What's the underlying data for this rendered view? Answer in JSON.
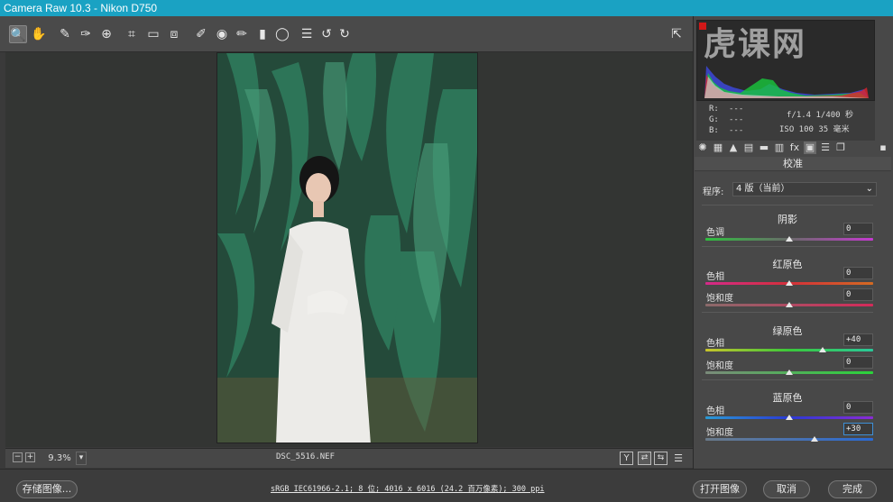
{
  "window": {
    "title": "Camera Raw 10.3 -  Nikon D750"
  },
  "toolbar": {
    "tools": [
      {
        "name": "zoom-tool",
        "icon": "magnifier-icon",
        "glyph": "🔍"
      },
      {
        "name": "hand-tool",
        "icon": "hand-icon",
        "glyph": "✋"
      },
      {
        "name": "white-balance-tool",
        "icon": "eyedropper-icon",
        "glyph": "✎"
      },
      {
        "name": "color-sampler-tool",
        "icon": "sampler-icon",
        "glyph": "✑"
      },
      {
        "name": "targeted-adjustment-tool",
        "icon": "target-icon",
        "glyph": "⊕"
      },
      {
        "name": "crop-tool",
        "icon": "crop-icon",
        "glyph": "⌗"
      },
      {
        "name": "straighten-tool",
        "icon": "ruler-icon",
        "glyph": "▭"
      },
      {
        "name": "transform-tool",
        "icon": "transform-icon",
        "glyph": "⧈"
      },
      {
        "name": "spot-removal-tool",
        "icon": "brush-heal-icon",
        "glyph": "✐"
      },
      {
        "name": "red-eye-tool",
        "icon": "eye-icon",
        "glyph": "◉"
      },
      {
        "name": "adjustment-brush-tool",
        "icon": "brush-icon",
        "glyph": "✏"
      },
      {
        "name": "graduated-filter-tool",
        "icon": "gradient-icon",
        "glyph": "▮"
      },
      {
        "name": "radial-filter-tool",
        "icon": "ellipse-icon",
        "glyph": "◯"
      },
      {
        "name": "preferences-tool",
        "icon": "list-icon",
        "glyph": "☰"
      },
      {
        "name": "rotate-left-tool",
        "icon": "rotate-left-icon",
        "glyph": "↺"
      },
      {
        "name": "rotate-right-tool",
        "icon": "rotate-right-icon",
        "glyph": "↻"
      }
    ],
    "fullscreen_glyph": "⇱"
  },
  "image": {
    "filename": "DSC_5516.NEF"
  },
  "statusbar": {
    "zoom": "9.3%",
    "zoom_out": "−",
    "zoom_in": "+",
    "dropdown": "▾",
    "before_after": "Y"
  },
  "bottom": {
    "save_label": "存储图像...",
    "workflow": "sRGB IEC61966-2.1; 8 位; 4016 x 6016 (24.2 百万像素); 300 ppi",
    "open_label": "打开图像",
    "cancel_label": "取消",
    "done_label": "完成"
  },
  "watermark": "虎课网",
  "info": {
    "r_label": "R:",
    "g_label": "G:",
    "b_label": "B:",
    "r_val": "---",
    "g_val": "---",
    "b_val": "---",
    "aperture_shutter": "f/1.4  1/400 秒",
    "iso_focal": "ISO 100  35 毫米"
  },
  "panel": {
    "title": "校准",
    "process_label": "程序:",
    "process_value": "4 版（当前）",
    "shadows": {
      "title": "阴影",
      "tint_label": "色调",
      "tint_value": "0",
      "tint": 0
    },
    "red": {
      "title": "红原色",
      "hue_label": "色相",
      "hue_value": "0",
      "hue": 0,
      "sat_label": "饱和度",
      "sat_value": "0",
      "sat": 0
    },
    "green": {
      "title": "绿原色",
      "hue_label": "色相",
      "hue_value": "+40",
      "hue": 40,
      "sat_label": "饱和度",
      "sat_value": "0",
      "sat": 0
    },
    "blue": {
      "title": "蓝原色",
      "hue_label": "色相",
      "hue_value": "0",
      "hue": 0,
      "sat_label": "饱和度",
      "sat_value": "+30",
      "sat": 30
    }
  },
  "colors": {
    "accent": "#1aa2c3"
  }
}
